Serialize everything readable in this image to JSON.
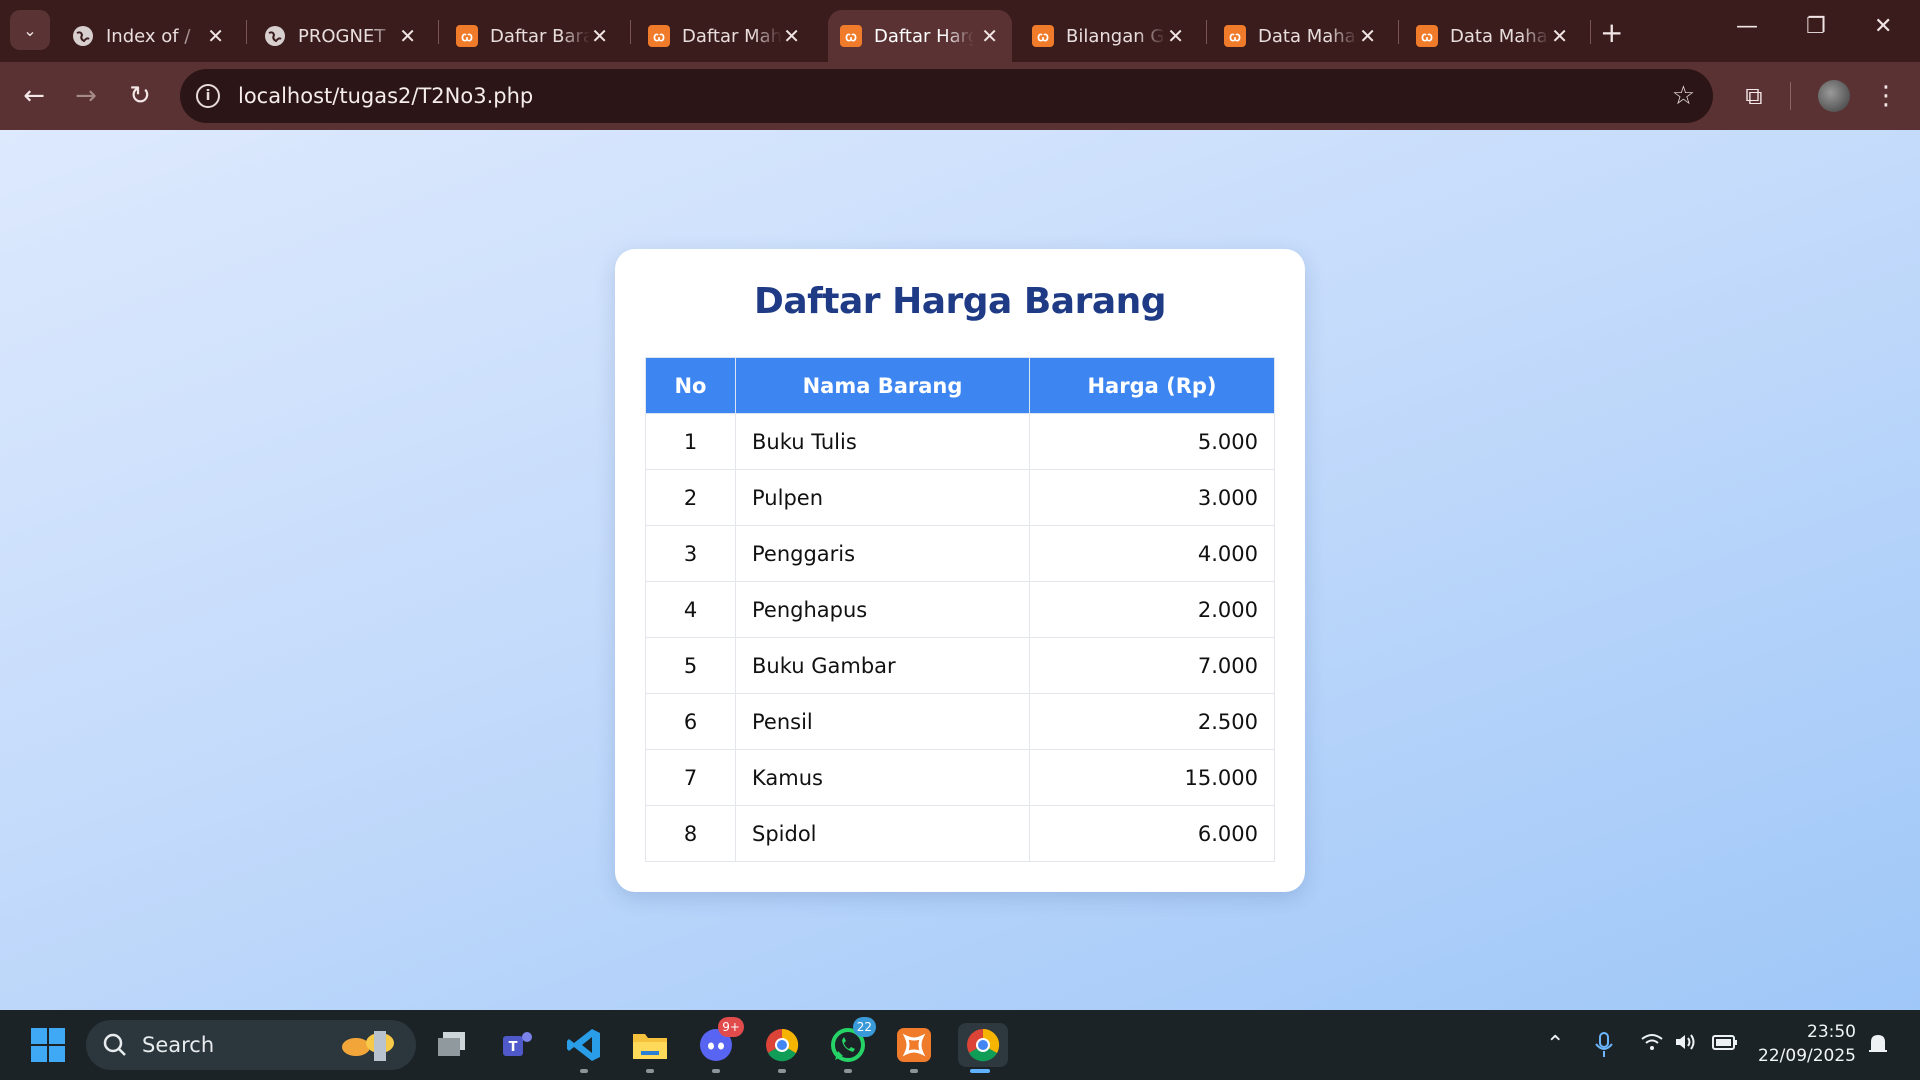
{
  "browser": {
    "tabs": [
      {
        "title": "Index of /",
        "icon": "globe-icon"
      },
      {
        "title": "PROGNET",
        "icon": "globe-icon"
      },
      {
        "title": "Daftar Barang",
        "icon": "xampp-icon"
      },
      {
        "title": "Daftar Mahasiswa",
        "icon": "xampp-icon"
      },
      {
        "title": "Daftar Harga",
        "icon": "xampp-icon",
        "active": true
      },
      {
        "title": "Bilangan Genap",
        "icon": "xampp-icon"
      },
      {
        "title": "Data Mahasiswa",
        "icon": "xampp-icon"
      },
      {
        "title": "Data Mahasiswa",
        "icon": "xampp-icon"
      }
    ],
    "url": "localhost/tugas2/T2No3.php"
  },
  "page": {
    "title": "Daftar Harga Barang",
    "table": {
      "headers": [
        "No",
        "Nama Barang",
        "Harga (Rp)"
      ],
      "rows": [
        [
          "1",
          "Buku Tulis",
          "5.000"
        ],
        [
          "2",
          "Pulpen",
          "3.000"
        ],
        [
          "3",
          "Penggaris",
          "4.000"
        ],
        [
          "4",
          "Penghapus",
          "2.000"
        ],
        [
          "5",
          "Buku Gambar",
          "7.000"
        ],
        [
          "6",
          "Pensil",
          "2.500"
        ],
        [
          "7",
          "Kamus",
          "15.000"
        ],
        [
          "8",
          "Spidol",
          "6.000"
        ]
      ]
    }
  },
  "taskbar": {
    "search_label": "Search",
    "discord_badge": "9+",
    "whatsapp_badge": "22",
    "time": "23:50",
    "date": "22/09/2025"
  },
  "colors": {
    "accent": "#3d86f2",
    "title": "#1f3b86"
  }
}
